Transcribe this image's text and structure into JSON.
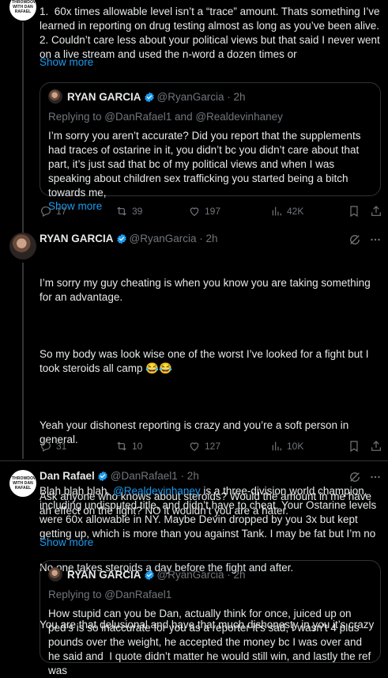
{
  "tweet1": {
    "text_line1": "1.  60x times allowable level isn’t a “trace” amount. Thats something I’ve learned in reporting on drug testing almost as long as you’ve been alive.",
    "text_line2": "2. Couldn’t care less about your political views but that said I never went on a live stream and used the n-word a dozen times or",
    "show_more": "Show more",
    "quote": {
      "name": "RYAN GARCIA",
      "handle": "@RyanGarcia",
      "time": "· 2h",
      "replying_prefix": "Replying to ",
      "replying_users": "@DanRafael1 and @Realdevinhaney",
      "text": "I’m sorry you aren’t accurate? Did you report that the supplements had traces of ostarine in it, you didn’t bc you didn’t care about that part, it’s just sad that bc of my political views and when I was speaking about children sex trafficking you started being a bitch towards me,",
      "show_more": "Show more"
    },
    "actions": {
      "replies": "17",
      "reposts": "39",
      "likes": "197",
      "views": "42K"
    }
  },
  "tweet2": {
    "name": "RYAN GARCIA",
    "handle": "@RyanGarcia",
    "time": "· 2h",
    "paragraphs": [
      "I’m sorry my guy cheating is when you know you are taking something for an advantage.",
      "So my body was look wise one of the worst I’ve looked for a fight but I took steroids all camp 😂😂",
      "Yeah your dishonest reporting is crazy and you’re a soft person in general.",
      "Ask anyone who knows about steroids? Would the amount in me have an effect on the fight? NO it wouldn’t you are a hater.",
      "No one takes steroids a day before the fight and after.",
      "You are that delusional and have that much dishonesty in you it’s crazy"
    ],
    "actions": {
      "replies": "31",
      "reposts": "10",
      "likes": "127",
      "views": "10K"
    }
  },
  "tweet3": {
    "name": "Dan Rafael",
    "handle": "@DanRafael1",
    "time": "· 2h",
    "avatar_text": "THROWDOWN WITH DAN RAFAEL",
    "text_start": "Blah blah blah. ",
    "mention": "@Realdevinhaney",
    "text_rest": " is a three-division world champion, including undisputed title, and didn’t have to cheat. Your Ostarine levels were 60x allowable in NY. Maybe Devin dropped by you 3x but kept getting up, which is more than you against Tank. I may be fat but I’m no",
    "show_more": "Show more",
    "quote": {
      "name": "RYAN GARCIA",
      "handle": "@RyanGarcia",
      "time": "· 2h",
      "replying_prefix": "Replying to ",
      "replying_users": "@DanRafael1",
      "text": "How stupid can you be Dan, actually think for once, juiced up on ped’s is so inaccurate for you as a reporter it’s sad, I wasn’t 4 plus pounds over the weight, he accepted the money bc I was over and he said and  I quote didn’t matter he would still win, and lastly the ref was"
    }
  },
  "colors": {
    "accent": "#1d9bf0",
    "muted": "#71767b",
    "text": "#e7e9ea",
    "border": "#2f3336",
    "background": "#000000"
  }
}
